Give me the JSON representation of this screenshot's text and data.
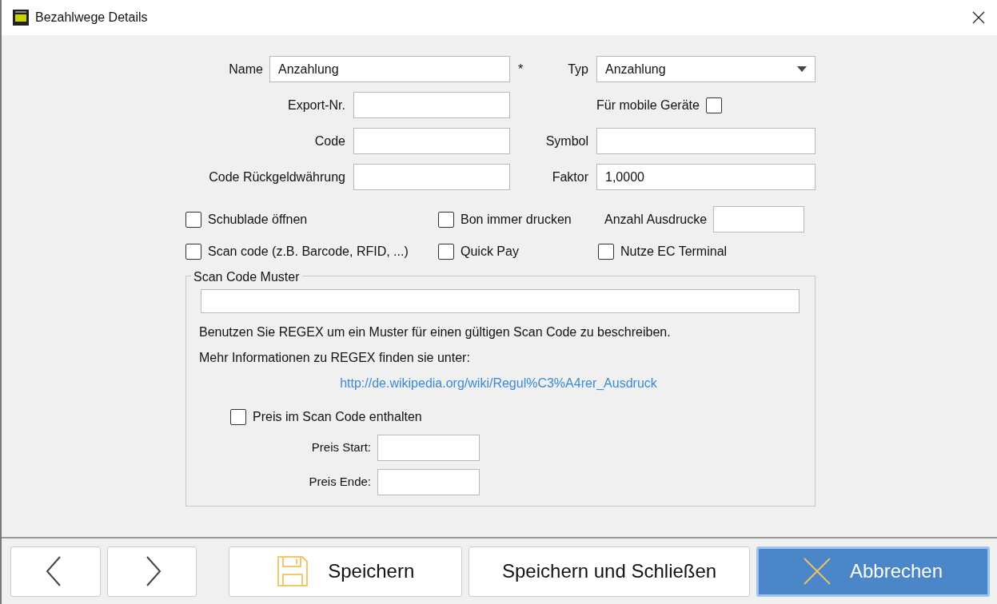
{
  "window": {
    "title": "Bezahlwege Details"
  },
  "form": {
    "name": {
      "label": "Name",
      "value": "Anzahlung"
    },
    "required_mark": "*",
    "type": {
      "label": "Typ",
      "value": "Anzahlung"
    },
    "export_nr": {
      "label": "Export-Nr."
    },
    "mobile": {
      "label": "Für mobile Geräte",
      "checked": false
    },
    "code": {
      "label": "Code"
    },
    "symbol": {
      "label": "Symbol"
    },
    "change_code": {
      "label": "Code Rückgeldwährung"
    },
    "factor": {
      "label": "Faktor",
      "value": "1,0000"
    },
    "option_rows": [
      [
        {
          "kind": "checkbox",
          "label": "Schublade öffnen",
          "checked": false
        },
        {
          "kind": "checkbox",
          "label": "Bon immer drucken",
          "checked": false
        },
        {
          "kind": "field",
          "label": "Anzahl Ausdrucke"
        }
      ],
      [
        {
          "kind": "checkbox",
          "label": "Scan code (z.B. Barcode, RFID, ...)",
          "checked": false
        },
        {
          "kind": "checkbox",
          "label": "Quick Pay",
          "checked": false
        },
        {
          "kind": "checkbox",
          "label": "Nutze EC Terminal",
          "checked": false
        }
      ]
    ]
  },
  "scan_group": {
    "legend": "Scan Code Muster",
    "help": [
      "Benutzen Sie REGEX um ein Muster für einen gültigen Scan Code zu beschreiben.",
      "Mehr Informationen zu REGEX finden sie unter:"
    ],
    "link": "http://de.wikipedia.org/wiki/Regul%C3%A4rer_Ausdruck",
    "price_included": {
      "label": "Preis im Scan Code enthalten",
      "checked": false
    },
    "price_start": {
      "label": "Preis Start:"
    },
    "price_end": {
      "label": "Preis Ende:"
    }
  },
  "buttons": [
    {
      "kind": "save",
      "label": "Speichern"
    },
    {
      "kind": "plain",
      "label": "Speichern und Schließen"
    },
    {
      "kind": "cancel",
      "label": "Abbrechen"
    }
  ]
}
